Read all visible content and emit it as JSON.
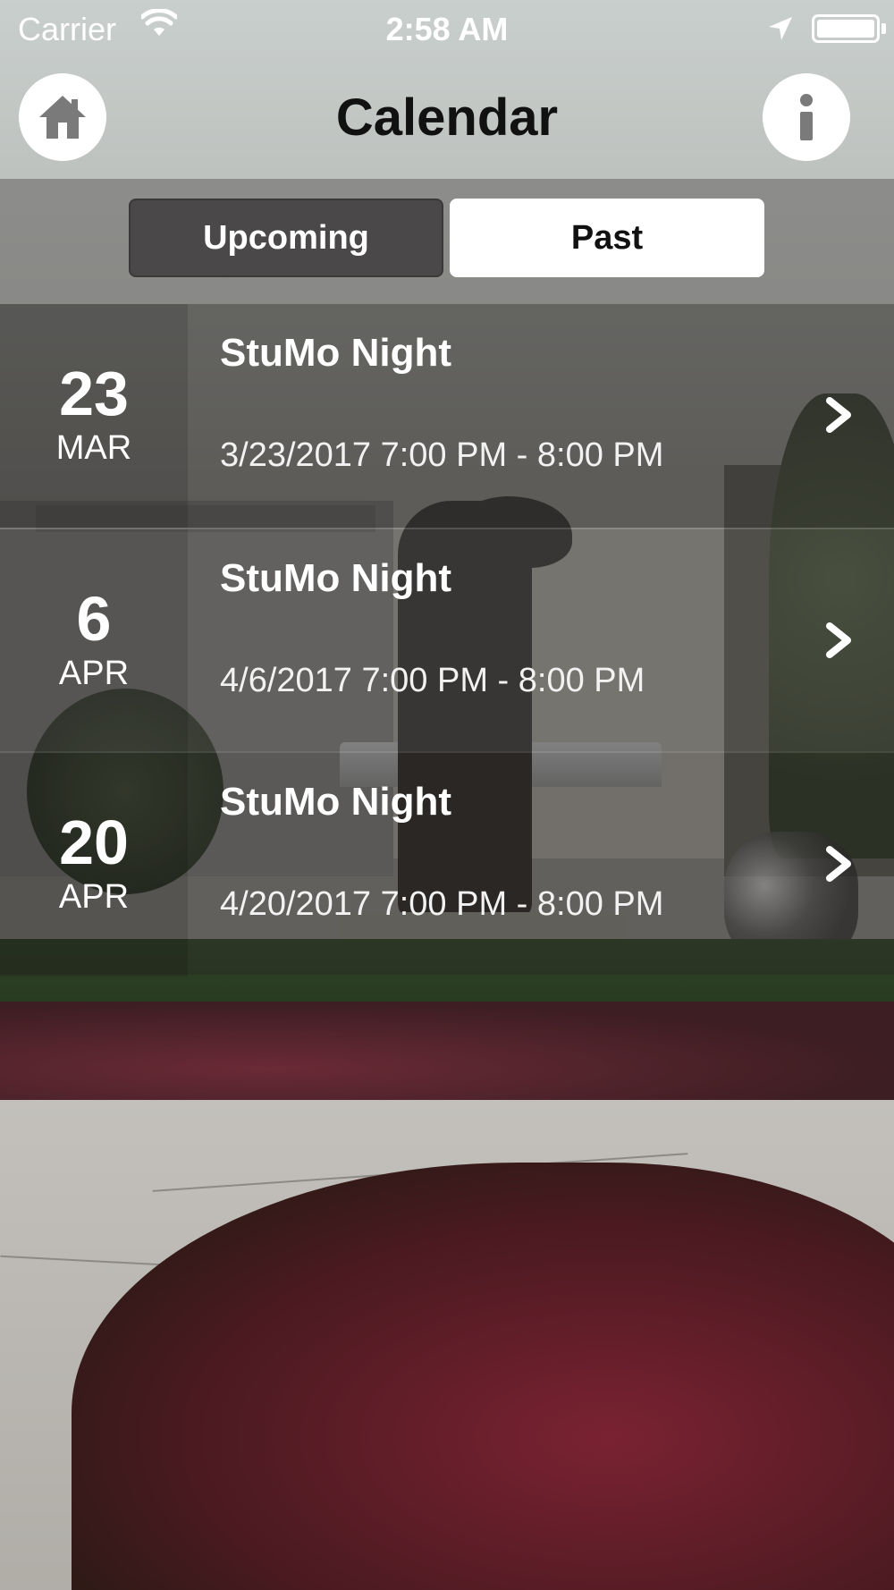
{
  "status_bar": {
    "carrier": "Carrier",
    "time": "2:58 AM"
  },
  "header": {
    "title": "Calendar",
    "home_icon": "home-icon",
    "info_icon": "info-icon"
  },
  "segments": {
    "upcoming": "Upcoming",
    "past": "Past",
    "selected": "past"
  },
  "events": [
    {
      "day": "23",
      "month": "MAR",
      "title": "StuMo Night",
      "time": "3/23/2017 7:00 PM - 8:00 PM"
    },
    {
      "day": "6",
      "month": "APR",
      "title": "StuMo Night",
      "time": "4/6/2017 7:00 PM - 8:00 PM"
    },
    {
      "day": "20",
      "month": "APR",
      "title": "StuMo Night",
      "time": "4/20/2017 7:00 PM - 8:00 PM"
    }
  ],
  "colors": {
    "segment_selected_bg": "#ffffff",
    "segment_unselected_bg": "#4a4848",
    "text_primary": "#ffffff"
  }
}
